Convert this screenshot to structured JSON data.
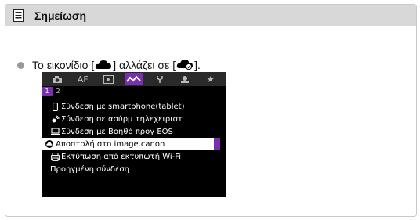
{
  "note": {
    "title": "Σημείωση",
    "icon": "note-icon"
  },
  "bullet": {
    "text_before": "Το εικονίδιο [",
    "text_middle": "] αλλάζει σε [",
    "text_after": "].",
    "icon_from": "cloud-icon",
    "icon_to": "cloud-check-icon"
  },
  "menu": {
    "tabs": [
      {
        "icon": "camera-icon",
        "label": "◘"
      },
      {
        "icon": "af-label",
        "label": "AF"
      },
      {
        "icon": "playback-icon",
        "label": "▶"
      },
      {
        "icon": "wireless-icon",
        "label": "∿"
      },
      {
        "icon": "wrench-icon",
        "label": "Ⲯ"
      },
      {
        "icon": "custom-icon",
        "label": "⚙"
      },
      {
        "icon": "star-icon",
        "label": "★"
      }
    ],
    "active_tab": 3,
    "pages": [
      "1",
      "2"
    ],
    "active_page": 0,
    "items": [
      {
        "icon": "smartphone-icon",
        "label": "Σύνδεση με smartphone(tablet)"
      },
      {
        "icon": "remote-icon",
        "label": "Σύνδεση σε ασύρμ τηλεχειριστ"
      },
      {
        "icon": "computer-icon",
        "label": "Σύνδεση με Βοηθό προγ EOS"
      },
      {
        "icon": "cloud-check-icon",
        "label": "Αποστολή στο image.canon"
      },
      {
        "icon": "printer-icon",
        "label": "Εκτύπωση από εκτυπωτή Wi-Fi"
      },
      {
        "icon": "",
        "label": "Προηγμένη σύνδεση"
      }
    ],
    "selected_item": 3
  },
  "colors": {
    "header_bg": "#d8d8d8",
    "accent": "#7a2fb0"
  }
}
